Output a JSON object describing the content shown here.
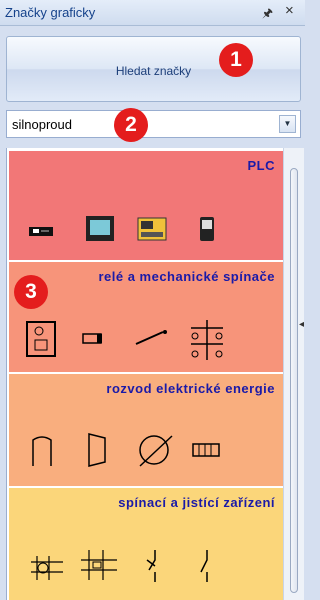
{
  "panel": {
    "title": "Značky graficky",
    "pin_icon": "pin-icon",
    "close_icon": "close-icon"
  },
  "search_button": {
    "label": "Hledat značky"
  },
  "combo": {
    "value": "silnoproud"
  },
  "badges": [
    "1",
    "2",
    "3"
  ],
  "categories": [
    {
      "label": "PLC",
      "color": "#f27777"
    },
    {
      "label": "relé a mechanické spínače",
      "color": "#f7947a"
    },
    {
      "label": "rozvod elektrické energie",
      "color": "#f9ae7e"
    },
    {
      "label": "spínací a jistící zařízení",
      "color": "#fbd67a"
    }
  ]
}
